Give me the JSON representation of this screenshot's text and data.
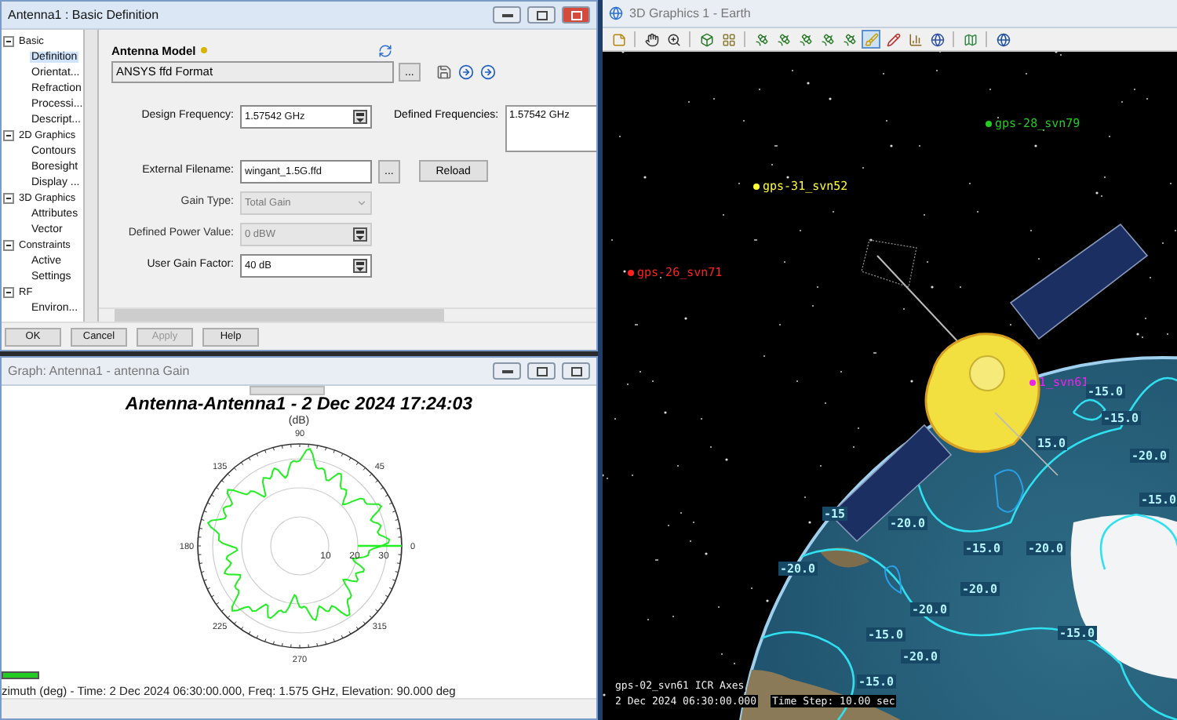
{
  "dialog": {
    "title": "Antenna1 : Basic Definition",
    "tree": [
      {
        "label": "Basic",
        "expanded": true,
        "children": [
          {
            "label": "Definition",
            "selected": true
          },
          {
            "label": "Orientat...",
            "selected": false
          },
          {
            "label": "Refraction",
            "selected": false
          },
          {
            "label": "Processi...",
            "selected": false
          },
          {
            "label": "Descript...",
            "selected": false
          }
        ]
      },
      {
        "label": "2D Graphics",
        "expanded": true,
        "children": [
          {
            "label": "Contours",
            "selected": false
          },
          {
            "label": "Boresight",
            "selected": false
          },
          {
            "label": "Display ...",
            "selected": false
          }
        ]
      },
      {
        "label": "3D Graphics",
        "expanded": true,
        "children": [
          {
            "label": "Attributes",
            "selected": false
          },
          {
            "label": "Vector",
            "selected": false
          }
        ]
      },
      {
        "label": "Constraints",
        "expanded": true,
        "children": [
          {
            "label": "Active",
            "selected": false
          },
          {
            "label": "Settings",
            "selected": false
          }
        ]
      },
      {
        "label": "RF",
        "expanded": true,
        "children": [
          {
            "label": "Environ...",
            "selected": false
          }
        ]
      }
    ],
    "model": {
      "label": "Antenna Model",
      "value": "ANSYS ffd Format",
      "browse": "..."
    },
    "fields": [
      {
        "kind": "unit",
        "label": "Design Frequency:",
        "value": "1.57542 GHz",
        "disabled": false
      },
      {
        "kind": "file",
        "label": "External Filename:",
        "value": "wingant_1.5G.ffd",
        "browse": "...",
        "action": "Reload",
        "disabled": false
      },
      {
        "kind": "select",
        "label": "Gain Type:",
        "value": "Total Gain",
        "disabled": true
      },
      {
        "kind": "unit",
        "label": "Defined Power Value:",
        "value": "0 dBW",
        "disabled": true
      },
      {
        "kind": "unit",
        "label": "User Gain Factor:",
        "value": "40 dB",
        "disabled": false
      }
    ],
    "defined_frequencies": {
      "label": "Defined Frequencies:",
      "items": [
        "1.57542 GHz"
      ]
    },
    "buttons": [
      {
        "label": "OK",
        "disabled": false
      },
      {
        "label": "Cancel",
        "disabled": false
      },
      {
        "label": "Apply",
        "disabled": true
      },
      {
        "label": "Help",
        "disabled": false
      }
    ]
  },
  "graph": {
    "title": "Graph:  Antenna1 - antenna Gain",
    "chart_title": "Antenna-Antenna1 -  2 Dec 2024 17:24:03",
    "unit": "(dB)",
    "angle_labels": [
      "0",
      "45",
      "90",
      "135",
      "180",
      "225",
      "270",
      "315"
    ],
    "radial_labels": [
      "10",
      "20",
      "30"
    ],
    "footer": "zimuth (deg) - Time: 2 Dec 2024 06:30:00.000, Freq: 1.575 GHz, Elevation: 90.000 deg"
  },
  "view3d": {
    "title": "3D Graphics 1 - Earth",
    "satellites": [
      {
        "name": "gps-28_svn79",
        "color": "#22cc22"
      },
      {
        "name": "gps-31_svn52",
        "color": "#ffff33"
      },
      {
        "name": "gps-26_svn71",
        "color": "#ff2020"
      },
      {
        "name": "1_svn61",
        "color": "#ee22ee"
      }
    ],
    "contour_labels": [
      "-15.0",
      "-15.0",
      "15.0",
      "-20.0",
      "-15.0",
      "-15",
      "-20.0",
      "-15.0",
      "-20.0",
      "-20.0",
      "-20.0",
      "-20.0",
      "-15.0",
      "-15.0",
      "-20.0",
      "-15.0"
    ],
    "overlay": [
      "gps-02_svn61 ICR Axes",
      "2 Dec 2024 06:30:00.000",
      "Time Step: 10.00 sec"
    ]
  }
}
